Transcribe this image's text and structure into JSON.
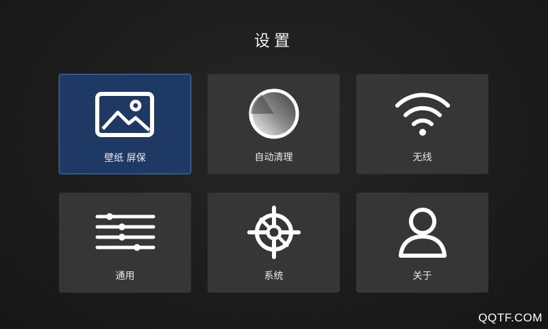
{
  "header": {
    "title": "设置"
  },
  "tiles": [
    {
      "label": "壁纸 屏保",
      "icon": "wallpaper-image-icon",
      "selected": true
    },
    {
      "label": "自动清理",
      "icon": "cleanup-dial-icon",
      "selected": false
    },
    {
      "label": "无线",
      "icon": "wifi-icon",
      "selected": false
    },
    {
      "label": "通用",
      "icon": "sliders-icon",
      "selected": false
    },
    {
      "label": "系统",
      "icon": "helm-wheel-icon",
      "selected": false
    },
    {
      "label": "关于",
      "icon": "user-profile-icon",
      "selected": false
    }
  ],
  "watermark": "QQTF.COM",
  "colors": {
    "selected_tile": "#1e3a64",
    "tile": "#363636",
    "background": "#1c1c1c"
  }
}
